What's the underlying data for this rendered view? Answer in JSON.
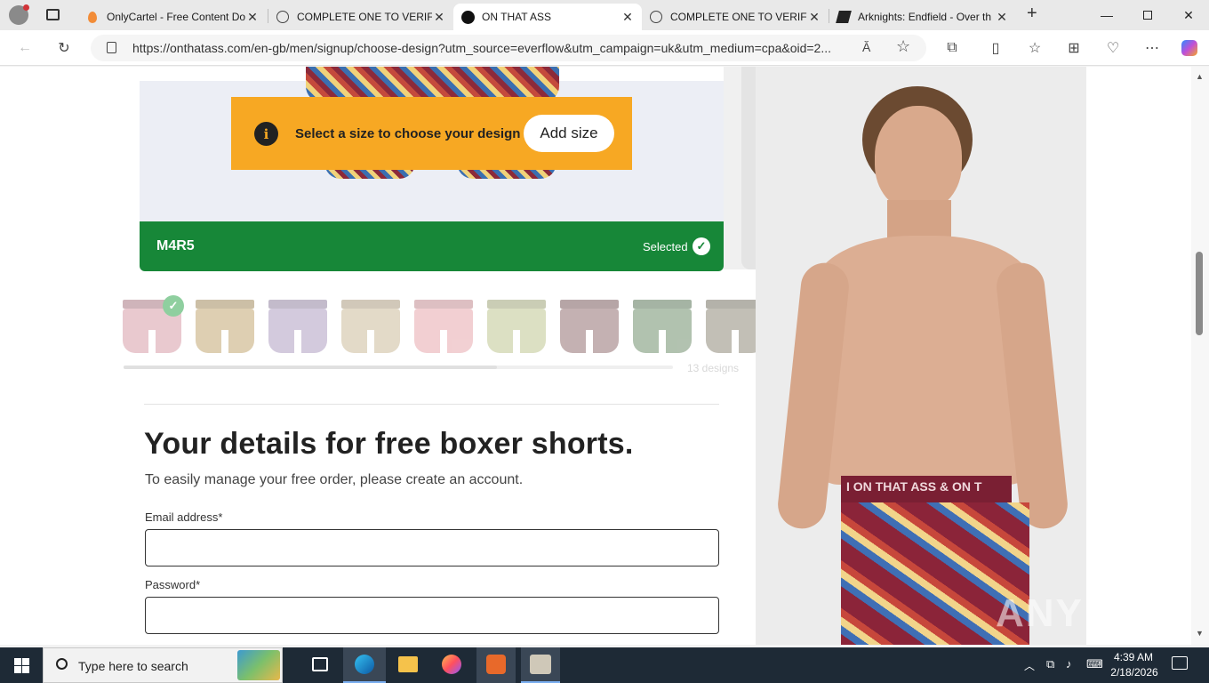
{
  "browser": {
    "tabs": [
      {
        "title": "OnlyCartel - Free Content Do",
        "active": false
      },
      {
        "title": "COMPLETE ONE TO VERIFY",
        "active": false
      },
      {
        "title": "ON THAT ASS",
        "active": true
      },
      {
        "title": "COMPLETE ONE TO VERIFY",
        "active": false
      },
      {
        "title": "Arknights: Endfield - Over th",
        "active": false
      }
    ],
    "url": "https://onthatass.com/en-gb/men/signup/choose-design?utm_source=everflow&utm_campaign=uk&utm_medium=cpa&oid=2...",
    "read_aloud": "Ă"
  },
  "product": {
    "banner_text": "Select a size to choose your design",
    "add_size_label": "Add size",
    "design_code": "M4R5",
    "selected_label": "Selected",
    "design_count": "13 designs",
    "thumbnail_colors": [
      "#e2b8c0",
      "#c9b07f",
      "#b7a7c8",
      "#d2c2a4",
      "#eab0b5",
      "#c6cc9c",
      "#9e7e7f",
      "#7e9a7b",
      "#9a9587"
    ],
    "waistband_text": "I ON THAT ASS & ON T"
  },
  "form": {
    "title": "Your details for free boxer shorts.",
    "subtitle": "To easily manage your free order, please create an account.",
    "email_label": "Email address*",
    "password_label": "Password*"
  },
  "watermark": "ANY RUN",
  "taskbar": {
    "search_placeholder": "Type here to search",
    "time": "4:39 AM",
    "date": "2/18/2026"
  }
}
